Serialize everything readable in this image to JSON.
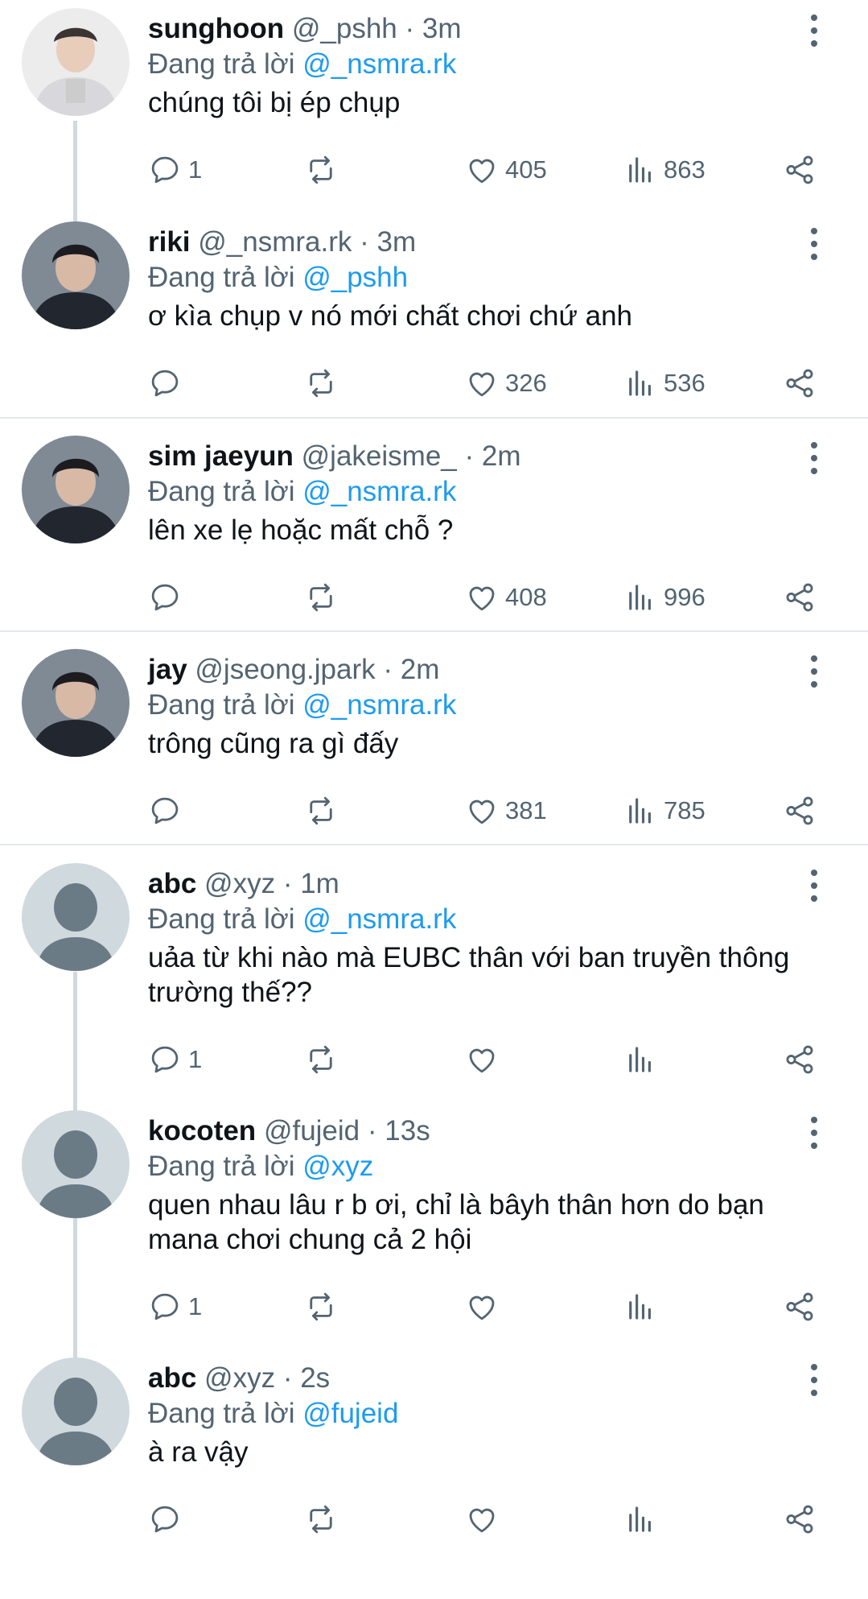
{
  "labels": {
    "reply_to": "Đang trả lời"
  },
  "tweets": [
    {
      "name": "sunghoon",
      "handle": "@_pshh",
      "time": "3m",
      "reply_to": "@_nsmra.rk",
      "text": "chúng tôi bị ép chụp",
      "replies": "1",
      "retweets": "",
      "likes": "405",
      "views": "863",
      "avatar": "photo-person-light"
    },
    {
      "name": "riki",
      "handle": "@_nsmra.rk",
      "time": "3m",
      "reply_to": "@_pshh",
      "text": "ơ kìa chụp v nó mới chất chơi chứ anh",
      "replies": "",
      "retweets": "",
      "likes": "326",
      "views": "536",
      "avatar": "photo-person-dark"
    },
    {
      "name": "sim jaeyun",
      "handle": "@jakeisme_",
      "time": "2m",
      "reply_to": "@_nsmra.rk",
      "text": "lên xe lẹ hoặc mất chỗ ?",
      "replies": "",
      "retweets": "",
      "likes": "408",
      "views": "996",
      "avatar": "photo-person-dark"
    },
    {
      "name": "jay",
      "handle": "@jseong.jpark",
      "time": "2m",
      "reply_to": "@_nsmra.rk",
      "text": "trông cũng ra gì đấy",
      "replies": "",
      "retweets": "",
      "likes": "381",
      "views": "785",
      "avatar": "photo-person-dark"
    },
    {
      "name": "abc",
      "handle": "@xyz",
      "time": "1m",
      "reply_to": "@_nsmra.rk",
      "text": "uảa từ khi nào mà EUBC thân với ban truyền thông trường thế??",
      "replies": "1",
      "retweets": "",
      "likes": "",
      "views": "",
      "avatar": "default-avatar"
    },
    {
      "name": "kocoten",
      "handle": "@fujeid",
      "time": "13s",
      "reply_to": "@xyz",
      "text": "quen nhau lâu r b ơi, chỉ là bâyh thân hơn do bạn mana chơi chung cả 2 hội",
      "replies": "1",
      "retweets": "",
      "likes": "",
      "views": "",
      "avatar": "default-avatar"
    },
    {
      "name": "abc",
      "handle": "@xyz",
      "time": "2s",
      "reply_to": "@fujeid",
      "text": "à ra vậy",
      "replies": "",
      "retweets": "",
      "likes": "",
      "views": "",
      "avatar": "default-avatar"
    }
  ],
  "colors": {
    "link": "#1d9bf0",
    "muted": "#536471",
    "text": "#0f1419",
    "thread_line": "#cfd9de",
    "default_avatar_bg": "#cfd9de",
    "default_avatar_fg": "#6b7b86"
  }
}
